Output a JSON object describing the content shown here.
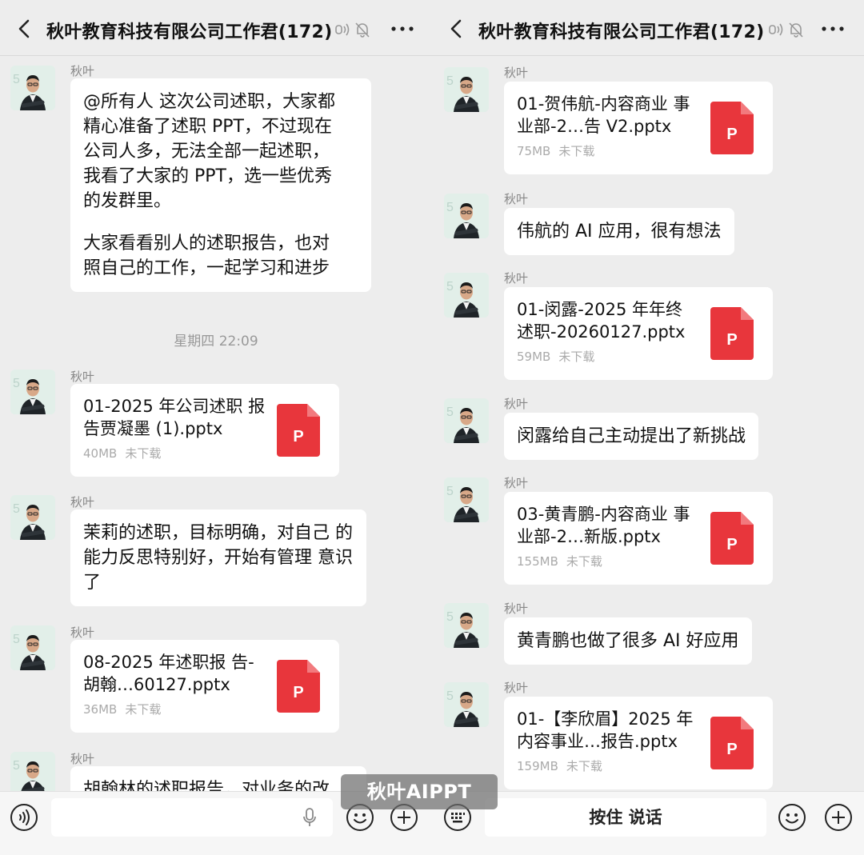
{
  "left": {
    "header": {
      "title": "秋叶教育科技有限公司工作君(172)"
    },
    "messages": {
      "m1": {
        "sender": "秋叶",
        "para1": "@所有人 这次公司述职，大家都\n精心准备了述职 PPT，不过现在\n公司人多，无法全部一起述职，\n我看了大家的 PPT，选一些优秀\n的发群里。",
        "para2": "大家看看别人的述职报告，也对\n照自己的工作，一起学习和进步"
      },
      "time": "星期四 22:09",
      "f1": {
        "sender": "秋叶",
        "name": "01-2025 年公司述职\n报告贾凝墨 (1).pptx",
        "size": "40MB",
        "status": "未下载",
        "icon_label": "P"
      },
      "m2": {
        "sender": "秋叶",
        "text": "茉莉的述职，目标明确，对自己\n的能力反思特别好，开始有管理\n意识了"
      },
      "f2": {
        "sender": "秋叶",
        "name": "08-2025 年述职报\n告-胡翰…60127.pptx",
        "size": "36MB",
        "status": "未下载",
        "icon_label": "P"
      },
      "m3": {
        "sender": "秋叶",
        "text": "胡翰林的述职报告，对业务的改"
      }
    }
  },
  "right": {
    "header": {
      "title": "秋叶教育科技有限公司工作君(172)"
    },
    "messages": {
      "f1": {
        "sender": "秋叶",
        "name": "01-贺伟航-内容商业\n事业部-2…告 V2.pptx",
        "size": "75MB",
        "status": "未下载",
        "icon_label": "P"
      },
      "m1": {
        "sender": "秋叶",
        "text": "伟航的 AI 应用，很有想法"
      },
      "f2": {
        "sender": "秋叶",
        "name": "01-闵露-2025 年年终\n述职-20260127.pptx",
        "size": "59MB",
        "status": "未下载",
        "icon_label": "P"
      },
      "m2": {
        "sender": "秋叶",
        "text": "闵露给自己主动提出了新挑战"
      },
      "f3": {
        "sender": "秋叶",
        "name": "03-黄青鹏-内容商业\n事业部-2…新版.pptx",
        "size": "155MB",
        "status": "未下载",
        "icon_label": "P"
      },
      "m3": {
        "sender": "秋叶",
        "text": "黄青鹏也做了很多 AI 好应用"
      },
      "f4": {
        "sender": "秋叶",
        "name": "01-【李欣眉】2025 年\n内容事业…报告.pptx",
        "size": "159MB",
        "status": "未下载",
        "icon_label": "P"
      }
    },
    "inputbar": {
      "hold_to_talk": "按住 说话"
    }
  },
  "watermark": "秋叶AIPPT",
  "colors": {
    "background": "#ededed",
    "bubble": "#ffffff",
    "ppt_red": "#e8363c",
    "meta_gray": "#aaaaaa"
  },
  "icons": [
    "back-arrow-icon",
    "voice-wave-icon",
    "mute-bell-icon",
    "more-icon",
    "voice-input-icon",
    "mic-icon",
    "emoji-icon",
    "plus-icon",
    "keyboard-icon",
    "ppt-file-icon"
  ]
}
